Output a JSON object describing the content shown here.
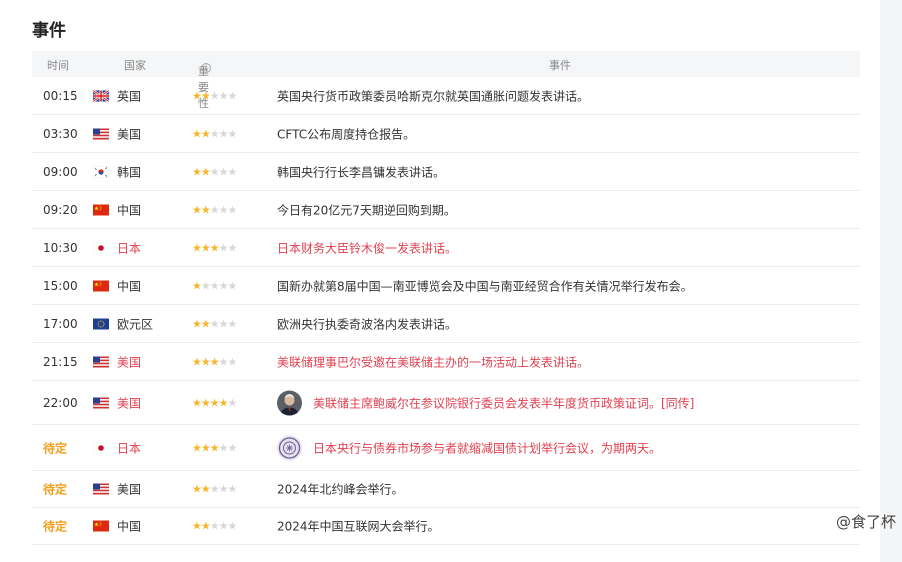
{
  "title": "事件",
  "headers": {
    "time": "时间",
    "country": "国家",
    "importance": "重要性",
    "event": "事件"
  },
  "colors": {
    "highlight": "#e04050",
    "pending": "#f0a020",
    "star_on": "#f7b52c",
    "star_off": "#d7d7d7"
  },
  "rows": [
    {
      "time": "00:15",
      "country": "英国",
      "flag": "uk-flag",
      "stars": 2,
      "event": "英国央行货币政策委员哈斯克尔就英国通胀问题发表讲话。",
      "highlight": false,
      "pending": false
    },
    {
      "time": "03:30",
      "country": "美国",
      "flag": "us-flag",
      "stars": 2,
      "event": "CFTC公布周度持仓报告。",
      "highlight": false,
      "pending": false
    },
    {
      "time": "09:00",
      "country": "韩国",
      "flag": "kr-flag",
      "stars": 2,
      "event": "韩国央行行长李昌镛发表讲话。",
      "highlight": false,
      "pending": false
    },
    {
      "time": "09:20",
      "country": "中国",
      "flag": "cn-flag",
      "stars": 2,
      "event": "今日有20亿元7天期逆回购到期。",
      "highlight": false,
      "pending": false
    },
    {
      "time": "10:30",
      "country": "日本",
      "flag": "jp-flag",
      "stars": 3,
      "event": "日本财务大臣铃木俊一发表讲话。",
      "highlight": true,
      "pending": false
    },
    {
      "time": "15:00",
      "country": "中国",
      "flag": "cn-flag",
      "stars": 1,
      "event": "国新办就第8届中国—南亚博览会及中国与南亚经贸合作有关情况举行发布会。",
      "highlight": false,
      "pending": false
    },
    {
      "time": "17:00",
      "country": "欧元区",
      "flag": "eu-flag",
      "stars": 2,
      "event": "欧洲央行执委奇波洛内发表讲话。",
      "highlight": false,
      "pending": false
    },
    {
      "time": "21:15",
      "country": "美国",
      "flag": "us-flag",
      "stars": 3,
      "event": "美联储理事巴尔受邀在美联储主办的一场活动上发表讲话。",
      "highlight": true,
      "pending": false
    },
    {
      "time": "22:00",
      "country": "美国",
      "flag": "us-flag",
      "stars": 4,
      "event": "美联储主席鲍威尔在参议院银行委员会发表半年度货币政策证词。[同传]",
      "highlight": true,
      "pending": false,
      "avatar": "portrait-avatar"
    },
    {
      "time": "待定",
      "country": "日本",
      "flag": "jp-flag",
      "stars": 3,
      "event": "日本央行与债券市场参与者就缩减国债计划举行会议，为期两天。",
      "highlight": true,
      "pending": true,
      "avatar": "seal-avatar"
    },
    {
      "time": "待定",
      "country": "美国",
      "flag": "us-flag",
      "stars": 2,
      "event": "2024年北约峰会举行。",
      "highlight": false,
      "pending": true
    },
    {
      "time": "待定",
      "country": "中国",
      "flag": "cn-flag",
      "stars": 2,
      "event": "2024年中国互联网大会举行。",
      "highlight": false,
      "pending": true
    }
  ],
  "signature": "@食了杯"
}
